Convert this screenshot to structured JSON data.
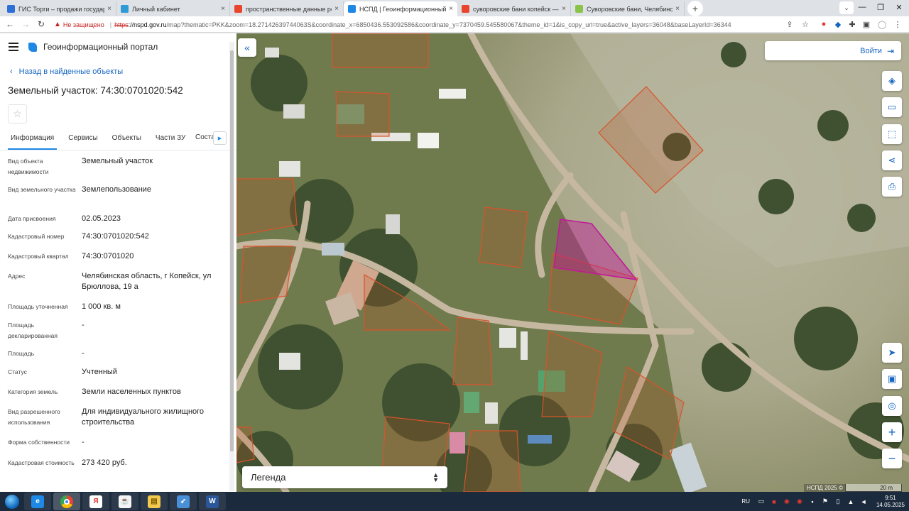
{
  "browser": {
    "tabs": [
      {
        "label": "ГИС Торги – продажи государст",
        "icon_color": "#2d6fd6"
      },
      {
        "label": "Личный кабинет",
        "icon_color": "#2e9bd6"
      },
      {
        "label": "пространственные данные рос",
        "icon_color": "#e8452c"
      },
      {
        "label": "НСПД | Геоинформационный п",
        "icon_color": "#1e88e5"
      },
      {
        "label": "суворовские бани копейск — Я",
        "icon_color": "#e8452c"
      },
      {
        "label": "Суворовские бани, Челябинска",
        "icon_color": "#8bc34a"
      }
    ],
    "active_tab_index": 3,
    "close_glyph": "×",
    "new_tab_glyph": "+",
    "security_label": "Не защищено",
    "url_scheme": "https",
    "url_host": "://nspd.gov.ru",
    "url_rest": "/map?thematic=PKK&zoom=18.27142639744063S&coordinate_x=6850436.553092586&coordinate_y=7370459.545580067&theme_id=1&is_copy_url=true&active_layers=36048&baseLayerId=36344"
  },
  "panel": {
    "portal_title": "Геоинформационный портал",
    "back_label": "Назад в найденные объекты",
    "object_title": "Земельный участок: 74:30:0701020:542",
    "tabs": [
      "Информация",
      "Сервисы",
      "Объекты",
      "Части ЗУ"
    ],
    "tab_overflow": "Соста",
    "active_tab": 0,
    "attributes": [
      {
        "key": "Вид объекта недвижимости",
        "value": "Земельный участок"
      },
      {
        "key": "Вид земельного участка",
        "value": "Землепользование"
      },
      {
        "key": "Дата присвоения",
        "value": "02.05.2023"
      },
      {
        "key": "Кадастровый номер",
        "value": "74:30:0701020:542"
      },
      {
        "key": "Кадастровый квартал",
        "value": "74:30:0701020"
      },
      {
        "key": "Адрес",
        "value": "Челябинская область, г Копейск, ул Брюллова, 19 а"
      },
      {
        "key": "Площадь уточненная",
        "value": "1 000 кв. м"
      },
      {
        "key": "Площадь декларированная",
        "value": "-"
      },
      {
        "key": "Площадь",
        "value": "-"
      },
      {
        "key": "Статус",
        "value": "Учтенный"
      },
      {
        "key": "Категория земель",
        "value": "Земли населенных пунктов"
      },
      {
        "key": "Вид разрешенного использования",
        "value": "Для индивидуального жилищного строительства"
      },
      {
        "key": "Форма собственности",
        "value": "-"
      },
      {
        "key": "Кадастровая стоимость",
        "value": "273 420 руб."
      }
    ]
  },
  "map": {
    "login_label": "Войти",
    "legend_label": "Легенда",
    "copyright": "НСПД 2025 ©",
    "scale_label": "20 m",
    "side_buttons": [
      "layers-icon",
      "ruler-icon",
      "select-area-icon",
      "share-icon",
      "print-icon"
    ],
    "bottom_buttons": [
      "locate-icon",
      "minimap-icon",
      "geo-search-icon",
      "zoom-in-icon",
      "zoom-out-icon"
    ],
    "highlight_color": "#c2189a",
    "parcel_color": "#d9532b"
  },
  "taskbar": {
    "lang": "RU",
    "time": "9:51",
    "date": "14.05.2025"
  }
}
